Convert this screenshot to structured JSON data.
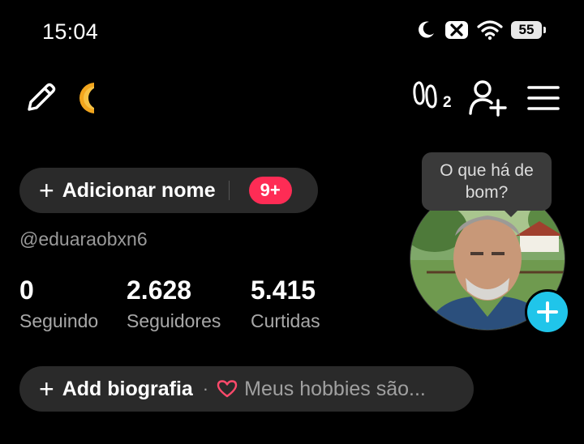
{
  "status_bar": {
    "time": "15:04",
    "battery": "55",
    "icons": [
      "moon-icon",
      "mute-notification-icon",
      "wifi-icon",
      "battery-icon"
    ]
  },
  "toolbar": {
    "icons": [
      "pencil-icon",
      "moon-icon",
      "footprints-icon",
      "add-user-icon",
      "hamburger-menu-icon"
    ],
    "footprint_count": "2"
  },
  "profile": {
    "add_name_label": "Adicionar nome",
    "notification_badge": "9+",
    "username": "@eduaraobxn6",
    "avatar_tooltip": "O que há de bom?",
    "stats": [
      {
        "value": "0",
        "label": "Seguindo"
      },
      {
        "value": "2.628",
        "label": "Seguidores"
      },
      {
        "value": "5.415",
        "label": "Curtidas"
      }
    ],
    "bio_label": "Add biografia",
    "bio_separator": "·",
    "bio_hint": "Meus hobbies são..."
  },
  "colors": {
    "background": "#000000",
    "pill": "#2a2a2a",
    "badge": "#fe2c55",
    "add_photo": "#20c5ea",
    "secondary_text": "#9a9a9a"
  }
}
